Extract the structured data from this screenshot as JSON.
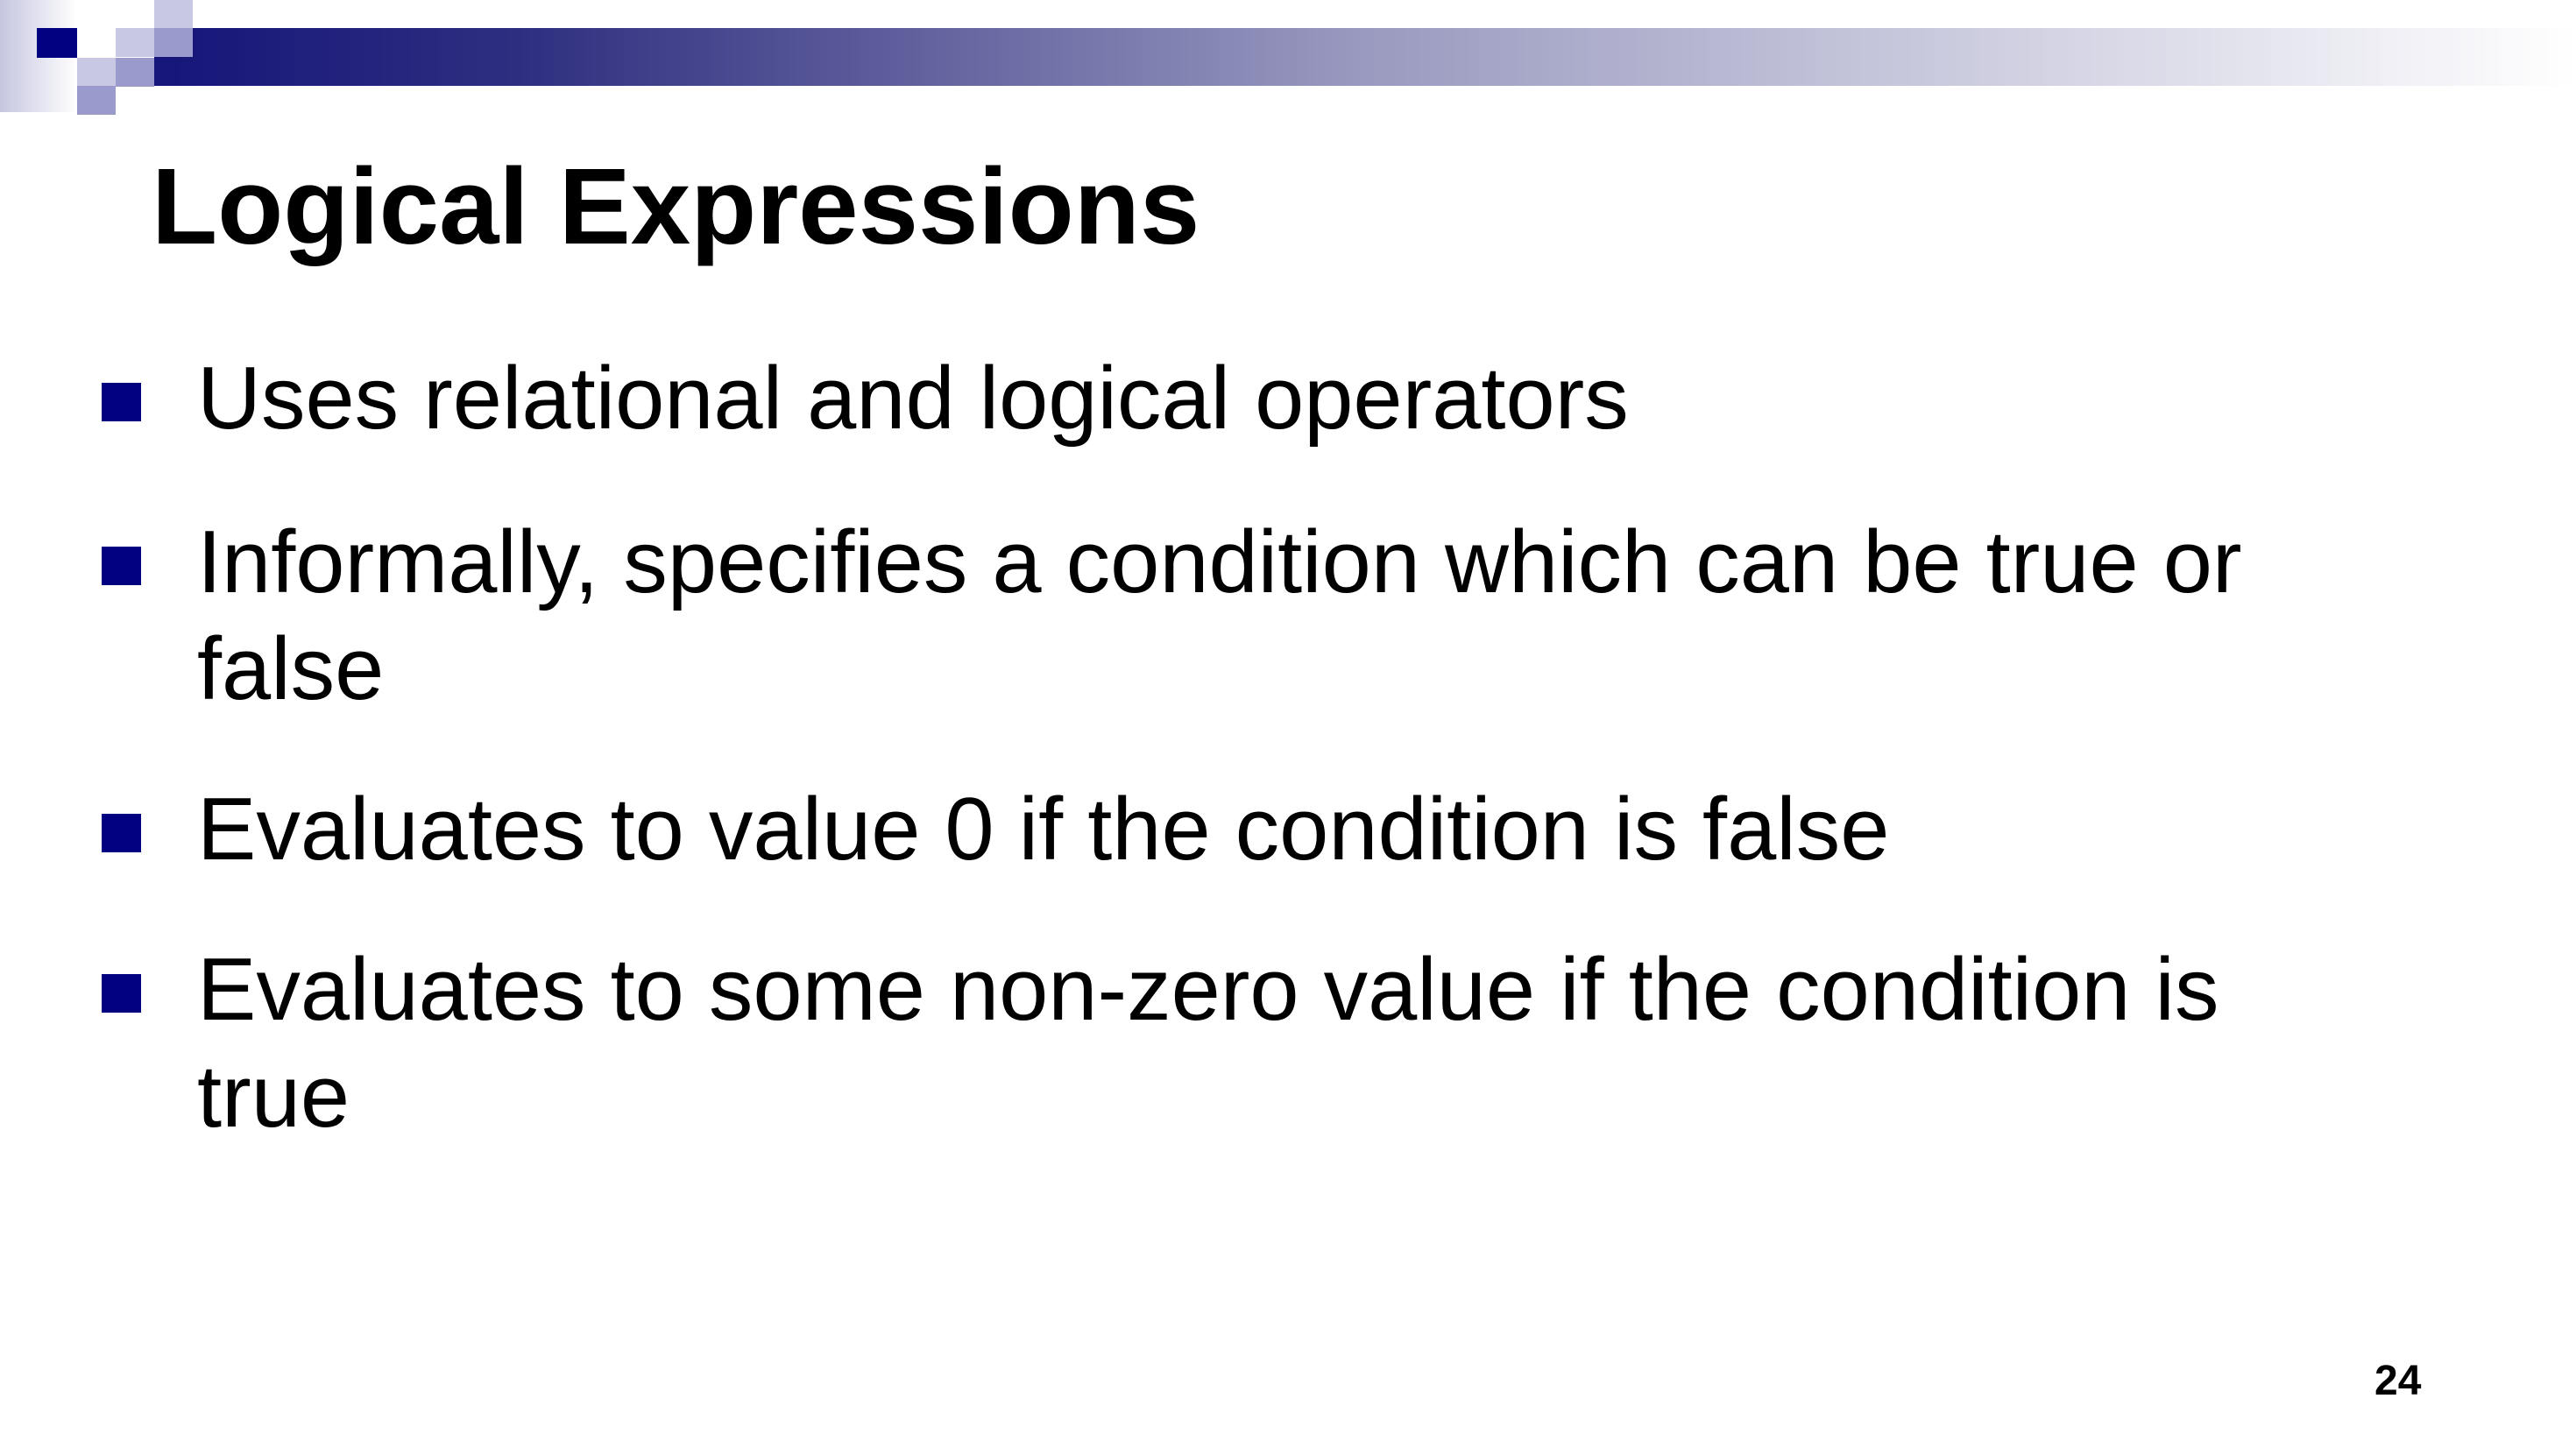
{
  "slide": {
    "title": "Logical Expressions",
    "bullets": [
      {
        "text": "Uses relational and logical operators"
      },
      {
        "text": "Informally, specifies a condition which can be true or false"
      },
      {
        "text": "Evaluates to value 0 if the condition is false"
      },
      {
        "text": "Evaluates to some non-zero value if the condition is true"
      }
    ],
    "page_number": "24"
  },
  "colors": {
    "accent": "#000080",
    "light_square": "#c8c8e4",
    "medium_square": "#9a9acc"
  }
}
